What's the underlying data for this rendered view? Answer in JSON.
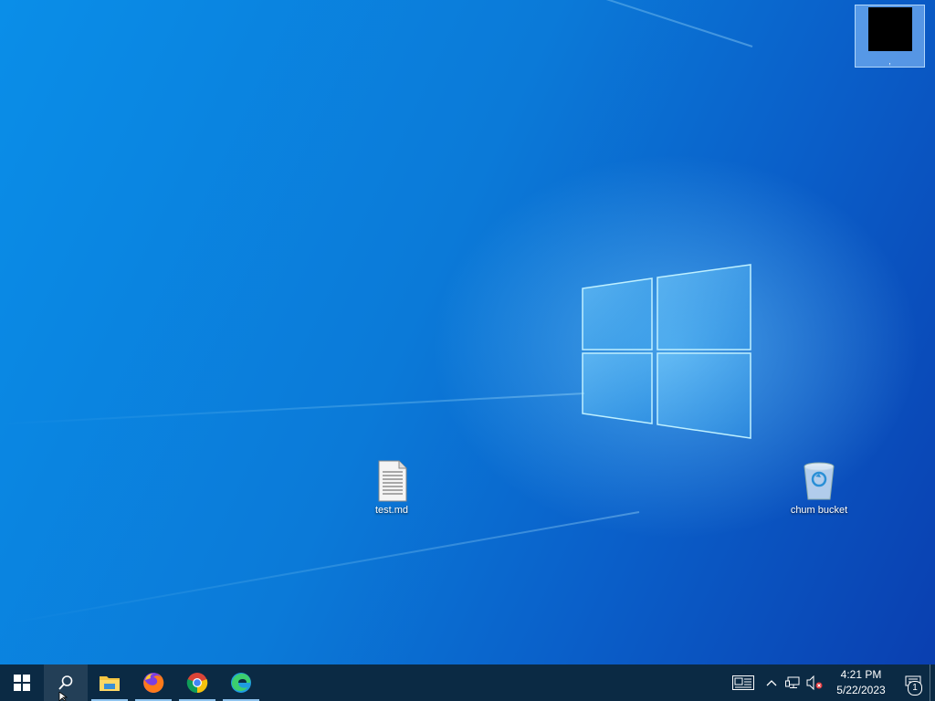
{
  "desktop": {
    "icons": [
      {
        "label": "test.md",
        "icon": "text-file-icon"
      },
      {
        "label": "chum bucket",
        "icon": "recycle-bin-icon"
      }
    ],
    "thumbnail": {
      "caption": ","
    }
  },
  "taskbar": {
    "pinned": [
      {
        "name": "start",
        "icon": "windows-logo-icon"
      },
      {
        "name": "search",
        "icon": "search-icon"
      },
      {
        "name": "file-explorer",
        "icon": "folder-icon"
      },
      {
        "name": "firefox",
        "icon": "firefox-icon"
      },
      {
        "name": "chrome",
        "icon": "chrome-icon"
      },
      {
        "name": "edge",
        "icon": "edge-icon"
      }
    ],
    "tray": {
      "time": "4:21 PM",
      "date": "5/22/2023",
      "notification_count": "1"
    }
  },
  "colors": {
    "taskbar": "#0b2a44",
    "desktop_accent": "#0a8ee8",
    "active_underline": "#8fc3ee"
  }
}
